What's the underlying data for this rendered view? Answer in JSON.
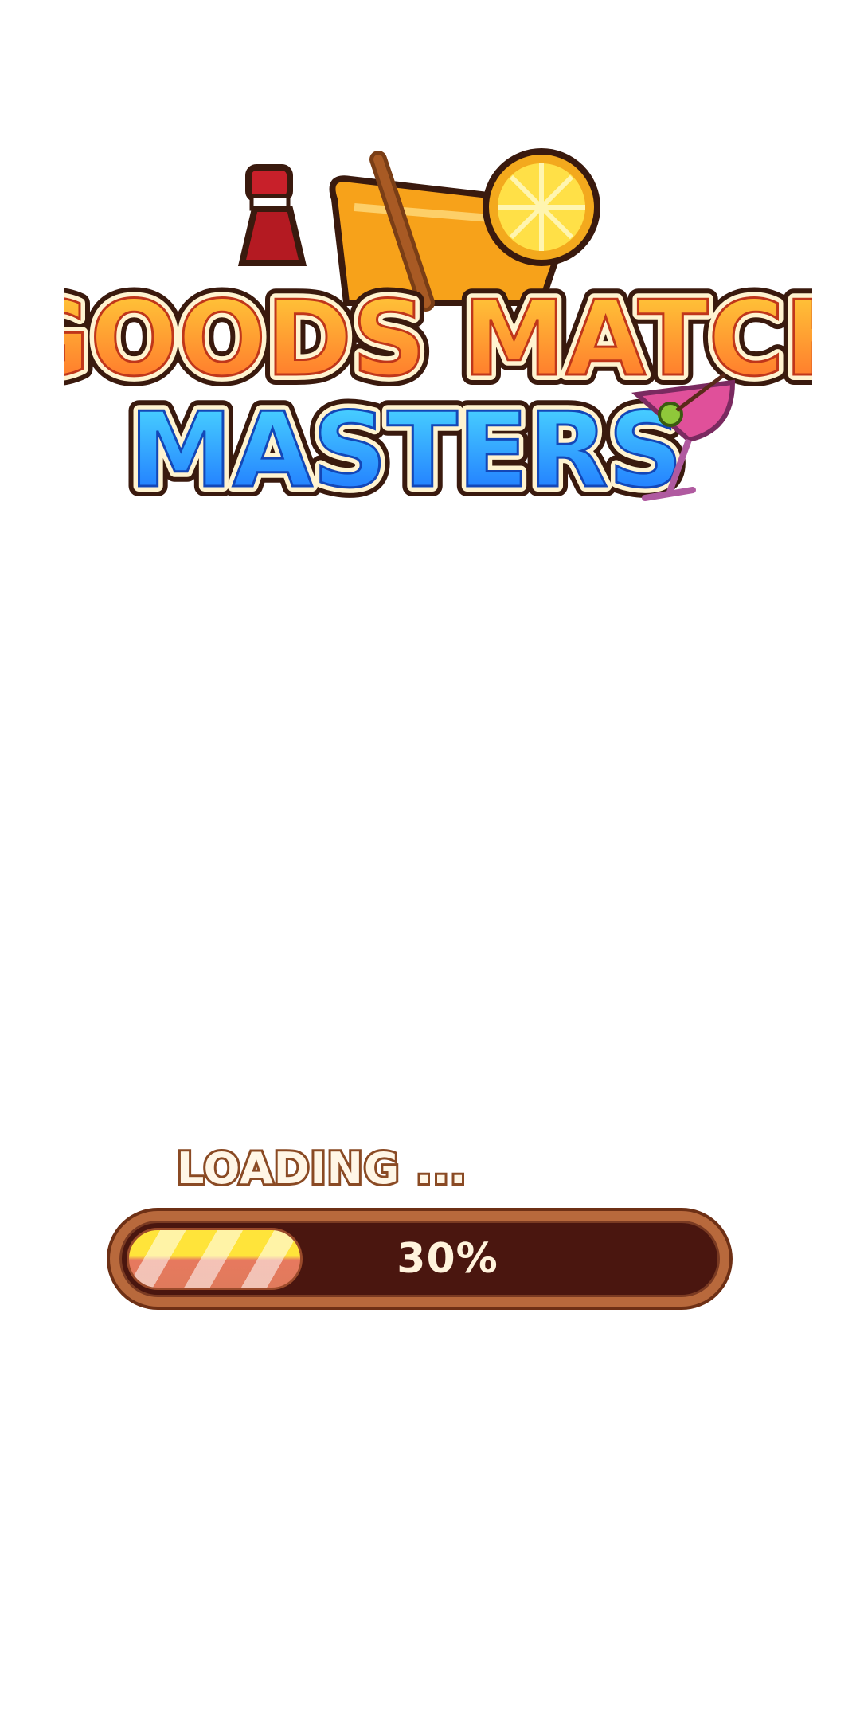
{
  "logo": {
    "line1": "GOODS MATCH",
    "line2": "MASTERS",
    "icons": [
      "soda-bottle-icon",
      "orange-juice-glass-icon",
      "lemon-slice-icon",
      "cocktail-glass-icon"
    ]
  },
  "loading": {
    "label": "LOADING ...",
    "percent_text": "30%",
    "progress": 0.3
  },
  "colors": {
    "frame": "#b8693c",
    "track": "#4a160f",
    "fill_top": "#ffe43a",
    "fill_bottom": "#e07a5c",
    "label_outline": "#8a4a24",
    "title_orange": "#ff9a1f",
    "title_blue": "#1e90ff"
  }
}
